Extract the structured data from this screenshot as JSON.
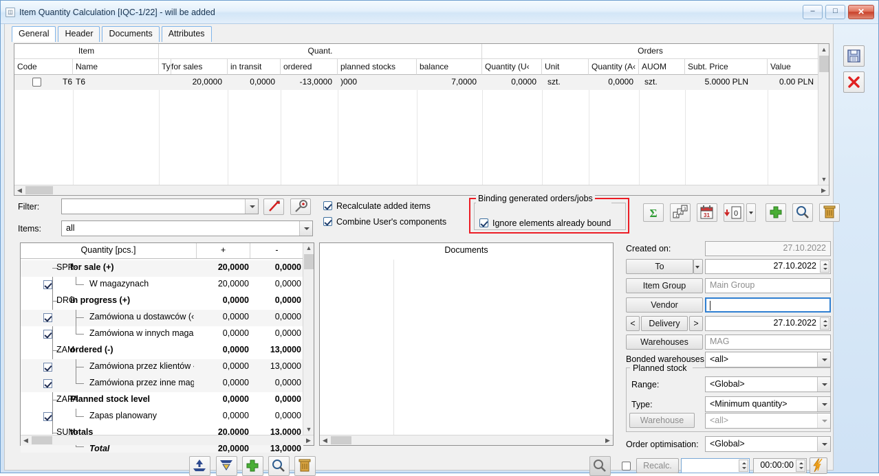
{
  "window": {
    "title": "Item Quantity Calculation [IQC-1/22] - will be added",
    "minimize_label": "–",
    "maximize_label": "□",
    "close_label": "✕"
  },
  "tabs": [
    {
      "label": "General",
      "active": true
    },
    {
      "label": "Header",
      "active": false
    },
    {
      "label": "Documents",
      "active": false
    },
    {
      "label": "Attributes",
      "active": false
    }
  ],
  "grid": {
    "group_headers": [
      "Item",
      "Quant.",
      "Orders"
    ],
    "columns": [
      "Code",
      "Name",
      "Typ",
      "for sales",
      "in transit",
      "ordered",
      "planned stocks",
      "balance",
      "Quantity (U‹",
      "Unit",
      "Quantity (A‹",
      "AUOM",
      "Subt. Price",
      "Value"
    ],
    "rows": [
      {
        "checked": false,
        "code": "T6",
        "name": "T6",
        "type": "",
        "for_sales": "20,0000",
        "in_transit": "0,0000",
        "ordered": "-13,0000",
        "planned_stocks": ")000",
        "balance": "7,0000",
        "quantity_uom": "0,0000",
        "unit": "szt.",
        "quantity_auom": "0,0000",
        "auom": "szt.",
        "subt_price": "5.0000 PLN",
        "value": "0.00 PLN"
      }
    ]
  },
  "filters": {
    "filter_label": "Filter:",
    "filter_value": "",
    "items_label": "Items:",
    "items_value": "all",
    "clear_filter_icon": "filter-pen-icon",
    "edit_filter_icon": "filter-key-icon"
  },
  "options": {
    "recalculate_label": "Recalculate added items",
    "recalculate_checked": true,
    "combine_label": "Combine User's components",
    "combine_checked": true
  },
  "binding": {
    "legend": "Binding generated orders/jobs",
    "ignore_label": "Ignore elements already bound",
    "ignore_checked": true,
    "highlight_color": "#ec1c24"
  },
  "toolbar": [
    {
      "name": "sum-button",
      "icon": "sigma-icon"
    },
    {
      "name": "sort-button",
      "icon": "sort-numeric-icon"
    },
    {
      "name": "calendar-button",
      "icon": "calendar-icon"
    },
    {
      "name": "zero-quantity-button",
      "icon": "arrow-to-zero-icon"
    },
    {
      "name": "dropdown-button",
      "icon": "chevron-down-icon"
    },
    {
      "name": "add-button",
      "icon": "plus-icon"
    },
    {
      "name": "find-button",
      "icon": "magnifier-icon"
    },
    {
      "name": "delete-button",
      "icon": "trash-icon"
    }
  ],
  "tree": {
    "headers": [
      "Quantity [pcs.]",
      "+",
      "-"
    ],
    "rows": [
      {
        "checkbox": null,
        "code": "SPR·",
        "label": "for sale (+)",
        "plus": "20,0000",
        "minus": "0,0000",
        "bold": true,
        "indent": 0,
        "italic": false
      },
      {
        "checkbox": true,
        "code": "",
        "label": "W magazynach",
        "plus": "20,0000",
        "minus": "0,0000",
        "bold": false,
        "indent": 1,
        "italic": false
      },
      {
        "checkbox": null,
        "code": "DRG·",
        "label": "in progress (+)",
        "plus": "0,0000",
        "minus": "0,0000",
        "bold": true,
        "indent": 0,
        "italic": false
      },
      {
        "checkbox": true,
        "code": "",
        "label": "Zamówiona u dostawców (‹",
        "plus": "0,0000",
        "minus": "0,0000",
        "bold": false,
        "indent": 1,
        "italic": false
      },
      {
        "checkbox": true,
        "code": "",
        "label": "Zamówiona w innych maga‹",
        "plus": "0,0000",
        "minus": "0,0000",
        "bold": false,
        "indent": 1,
        "italic": false
      },
      {
        "checkbox": null,
        "code": "ZAM·",
        "label": "ordered (-)",
        "plus": "0,0000",
        "minus": "13,0000",
        "bold": true,
        "indent": 0,
        "italic": false
      },
      {
        "checkbox": true,
        "code": "",
        "label": "Zamówiona przez klientów ‹",
        "plus": "0,0000",
        "minus": "13,0000",
        "bold": false,
        "indent": 1,
        "italic": false
      },
      {
        "checkbox": true,
        "code": "",
        "label": "Zamówiona przez inne mag‹",
        "plus": "0,0000",
        "minus": "0,0000",
        "bold": false,
        "indent": 1,
        "italic": false
      },
      {
        "checkbox": null,
        "code": "ZAPA",
        "label": "Planned stock level",
        "plus": "0,0000",
        "minus": "0,0000",
        "bold": true,
        "indent": 0,
        "italic": false
      },
      {
        "checkbox": true,
        "code": "",
        "label": "Zapas planowany",
        "plus": "0,0000",
        "minus": "0,0000",
        "bold": false,
        "indent": 1,
        "italic": false
      },
      {
        "checkbox": null,
        "code": "SUM‹",
        "label": "totals",
        "plus": "20,0000",
        "minus": "13,0000",
        "bold": true,
        "indent": 0,
        "italic": false
      },
      {
        "checkbox": null,
        "code": "",
        "label": "Total",
        "plus": "20,0000",
        "minus": "13,0000",
        "bold": true,
        "indent": 1,
        "italic": true
      }
    ]
  },
  "documents": {
    "title": "Documents"
  },
  "form": {
    "created_on_label": "Created on:",
    "created_on_value": "27.10.2022",
    "to_label": "To",
    "to_value": "27.10.2022",
    "item_group_label": "Item Group",
    "item_group_value": "Main Group",
    "vendor_label": "Vendor",
    "vendor_value": "",
    "delivery_prev_label": "<",
    "delivery_label": "Delivery",
    "delivery_next_label": ">",
    "delivery_value": "27.10.2022",
    "warehouses_label": "Warehouses",
    "warehouses_value": "MAG",
    "bonded_label": "Bonded warehouses",
    "bonded_value": "<all>",
    "planned_stock_legend": "Planned stock",
    "range_label": "Range:",
    "range_value": "<Global>",
    "type_label": "Type:",
    "type_value": "<Minimum quantity>",
    "warehouse_label": "Warehouse",
    "warehouse_value": "<all>",
    "order_optimisation_label": "Order optimisation:",
    "order_optimisation_value": "<Global>",
    "recalc_checked": false,
    "recalc_label": "Recalc.",
    "recalc_value": "",
    "recalc_time": "00:00:00",
    "recalc_run_icon": "lightning-icon"
  },
  "bottom_toolbar": [
    {
      "name": "export-button",
      "icon": "upload-icon"
    },
    {
      "name": "import-button",
      "icon": "download-icon"
    },
    {
      "name": "add-row-button",
      "icon": "plus-icon"
    },
    {
      "name": "find-row-button",
      "icon": "magnifier-icon"
    },
    {
      "name": "delete-row-button",
      "icon": "trash-icon"
    }
  ],
  "documents_search_icon": "magnifier-icon",
  "side_toolbar": [
    {
      "name": "save-button",
      "icon": "floppy-disk-icon"
    },
    {
      "name": "cancel-button",
      "icon": "red-x-icon"
    }
  ]
}
